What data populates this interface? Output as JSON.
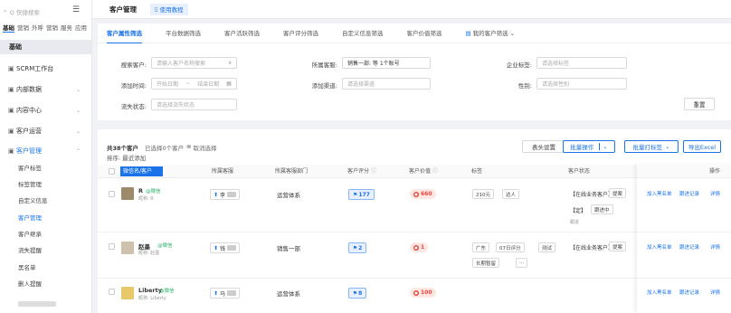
{
  "sidebar": {
    "search_placeholder": "Q 快捷搜索",
    "tabs": [
      "基础",
      "营销",
      "外呼",
      "营销",
      "服务",
      "应用"
    ],
    "basic_label": "基础",
    "items": [
      {
        "label": "SCRM工作台",
        "icon": "grid-icon"
      },
      {
        "label": "内部数据",
        "icon": "grid-icon"
      },
      {
        "label": "内容中心",
        "icon": "grid-icon"
      },
      {
        "label": "客户运营",
        "icon": "grid-icon"
      },
      {
        "label": "客户管理",
        "icon": "grid-icon"
      }
    ],
    "subitems": [
      "客户标签",
      "标签管理",
      "自定义信息",
      "客户管理",
      "客户继承",
      "流失提醒",
      "黑名单",
      "删人提醒"
    ]
  },
  "topbar": {
    "title": "客户管理",
    "tab_label": "使用教程"
  },
  "filter": {
    "tabs": [
      "客户属性筛选",
      "平台数据筛选",
      "客户活跃筛选",
      "客户评分筛选",
      "自定义信息筛选",
      "客户价值筛选",
      "我的客户筛选"
    ],
    "search_label": "搜索客户:",
    "search_placeholder": "请输入客户名称搜索",
    "owner_label": "所属客服:",
    "owner_value": "销售一部: 等 1个账号",
    "corp_tag_label": "企业标签:",
    "corp_tag_placeholder": "请选择标签",
    "add_time_label": "添加时间:",
    "date_start": "开始日期",
    "date_sep": "~",
    "date_end": "结束日期",
    "add_channel_label": "添加渠道:",
    "add_channel_placeholder": "请选择渠道",
    "gender_label": "性别:",
    "gender_placeholder": "请选择性别",
    "churn_label": "流失状态:",
    "churn_placeholder": "请选择流失状态",
    "reset_label": "重置"
  },
  "list": {
    "total": "共38个客户",
    "selected": "已选择0个客户",
    "cancel_select": "取消选择",
    "sort_label": "排序: 最近添加",
    "btn_columns": "表头设置",
    "btn_batch": "批量操作",
    "btn_batch_tag": "批量打标签",
    "btn_export": "导出Excel",
    "headers": [
      "微信名/客户",
      "所属客服",
      "所属客服部门",
      "客户评分",
      "客户价值",
      "标签",
      "客户状态",
      "操作"
    ],
    "rows": [
      {
        "name": "R",
        "channel": "@微信",
        "remark": "昵称: R",
        "owner": "李",
        "dept": "运营体系",
        "score": "177",
        "value": "660",
        "tags": [
          "210元",
          "达人"
        ],
        "status": [
          "【在线业务客户】",
          "【定】",
          "跟进中"
        ],
        "status_extra": "跟进",
        "ops": [
          "加入黑名单",
          "跟进记录",
          "详情"
        ]
      },
      {
        "name": "赵墨",
        "channel": "@微信",
        "remark": "昵称: 赵墨",
        "owner": "钱",
        "dept": "销售一部",
        "score": "2",
        "value": "1",
        "tags": [
          "广东",
          "07日评分",
          "测试",
          "长期暂留"
        ],
        "status": [
          "【在线业务客户】"
        ],
        "status_extra": "",
        "ops": [
          "加入黑名单",
          "跟进记录",
          "详情"
        ]
      },
      {
        "name": "Liberty",
        "channel": "@微信",
        "remark": "昵称: Liberty",
        "owner": "马",
        "dept": "运营体系",
        "score": "8",
        "value": "100",
        "tags": [],
        "status": [],
        "status_extra": "",
        "ops": [
          "加入黑名单",
          "跟进记录",
          "详情"
        ]
      }
    ]
  }
}
